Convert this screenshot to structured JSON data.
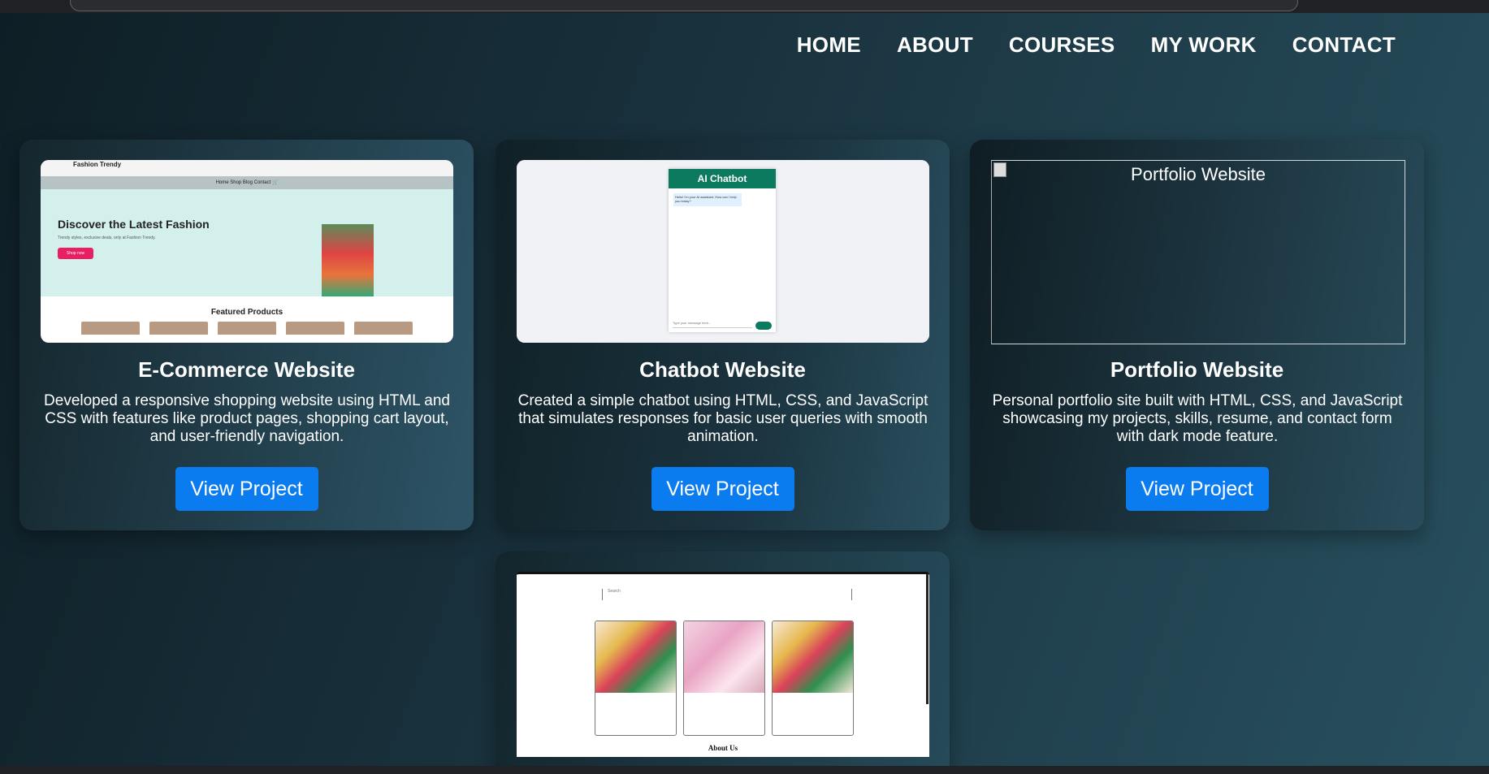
{
  "nav": {
    "items": [
      "HOME",
      "ABOUT",
      "COURSES",
      "MY WORK",
      "CONTACT"
    ]
  },
  "projects": [
    {
      "title": "E-Commerce Website",
      "description": "Developed a responsive shopping website using HTML and CSS with features like product pages, shopping cart layout, and user-friendly navigation.",
      "button": "View Project",
      "thumb": {
        "brand": "Fashion Trendy",
        "menu": "Home    Shop    Blog    Contact    🛒",
        "hero_title": "Discover the Latest Fashion",
        "hero_sub": "Trendy styles, exclusive deals, only at Fashion Trendy.",
        "hero_button": "Shop now",
        "featured": "Featured Products"
      }
    },
    {
      "title": "Chatbot Website",
      "description": "Created a simple chatbot using HTML, CSS, and JavaScript that simulates responses for basic user queries with smooth animation.",
      "button": "View Project",
      "thumb": {
        "header": "AI Chatbot",
        "bot_message": "Hello! I'm your AI assistant. How can I help you today?",
        "input_placeholder": "Type your message here..."
      }
    },
    {
      "title": "Portfolio Website",
      "description": "Personal portfolio site built with HTML, CSS, and JavaScript showcasing my projects, skills, resume, and contact form with dark mode feature.",
      "button": "View Project",
      "thumb": {
        "alt": "Portfolio Website"
      }
    },
    {
      "thumb": {
        "search_placeholder": "Search",
        "about": "About Us"
      }
    }
  ]
}
